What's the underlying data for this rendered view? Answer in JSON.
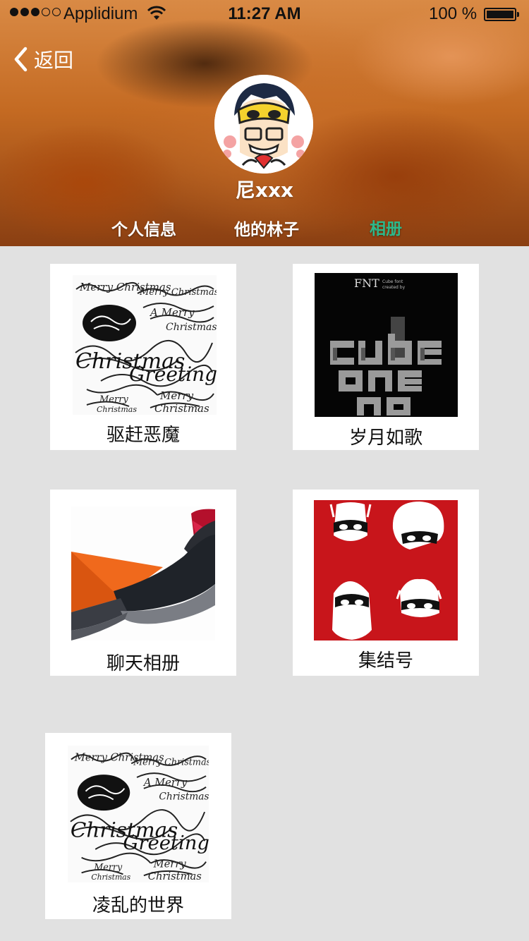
{
  "status": {
    "carrier": "Applidium",
    "time": "11:27 AM",
    "battery": "100 %"
  },
  "nav": {
    "back_label": "返回"
  },
  "profile": {
    "name": "尼xxx"
  },
  "tabs": [
    {
      "label": "个人信息",
      "active": false
    },
    {
      "label": "他的林子",
      "active": false
    },
    {
      "label": "相册",
      "active": true
    }
  ],
  "albums": [
    {
      "title": "驱赶恶魔",
      "cover": "christmas-greetings-calligraphy"
    },
    {
      "title": "岁月如歌",
      "cover": "cube-font-poster"
    },
    {
      "title": "聊天相册",
      "cover": "orange-dark-product"
    },
    {
      "title": "集结号",
      "cover": "masked-heroes-red"
    },
    {
      "title": "凌乱的世界",
      "cover": "christmas-greetings-calligraphy"
    }
  ],
  "colors": {
    "active_tab": "#2db88b",
    "page_bg": "#e1e1e1",
    "card_bg": "#ffffff"
  }
}
